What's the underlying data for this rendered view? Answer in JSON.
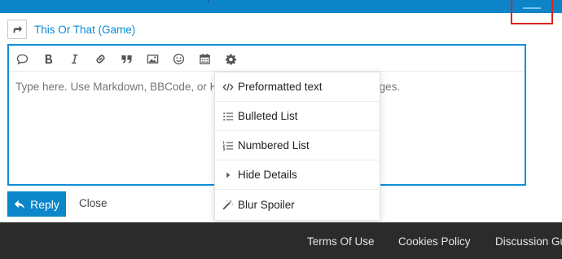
{
  "header": {
    "accent_color": "#0d83c8",
    "menu_icon": "hamburger-icon"
  },
  "reply_to": {
    "icon": "share-arrow-icon",
    "topic_title": "This Or That (Game)"
  },
  "toolbar": {
    "buttons": [
      {
        "name": "quote-icon"
      },
      {
        "name": "bold-icon"
      },
      {
        "name": "italic-icon"
      },
      {
        "name": "link-icon"
      },
      {
        "name": "blockquote-icon"
      },
      {
        "name": "image-icon"
      },
      {
        "name": "emoji-icon"
      },
      {
        "name": "calendar-icon"
      },
      {
        "name": "gear-icon"
      }
    ]
  },
  "composer": {
    "placeholder": "Type here. Use Markdown, BBCode, or HTML to format. Drag or paste images."
  },
  "options_menu": {
    "items": [
      {
        "label": "Preformatted text",
        "icon": "code-icon"
      },
      {
        "label": "Bulleted List",
        "icon": "bulleted-list-icon"
      },
      {
        "label": "Numbered List",
        "icon": "numbered-list-icon"
      },
      {
        "label": "Hide Details",
        "icon": "caret-right-icon"
      },
      {
        "label": "Blur Spoiler",
        "icon": "magic-wand-icon"
      }
    ]
  },
  "actions": {
    "reply_label": "Reply",
    "close_label": "Close"
  },
  "footer": {
    "links": [
      "Terms Of Use",
      "Cookies Policy",
      "Discussion Guidelines"
    ]
  }
}
